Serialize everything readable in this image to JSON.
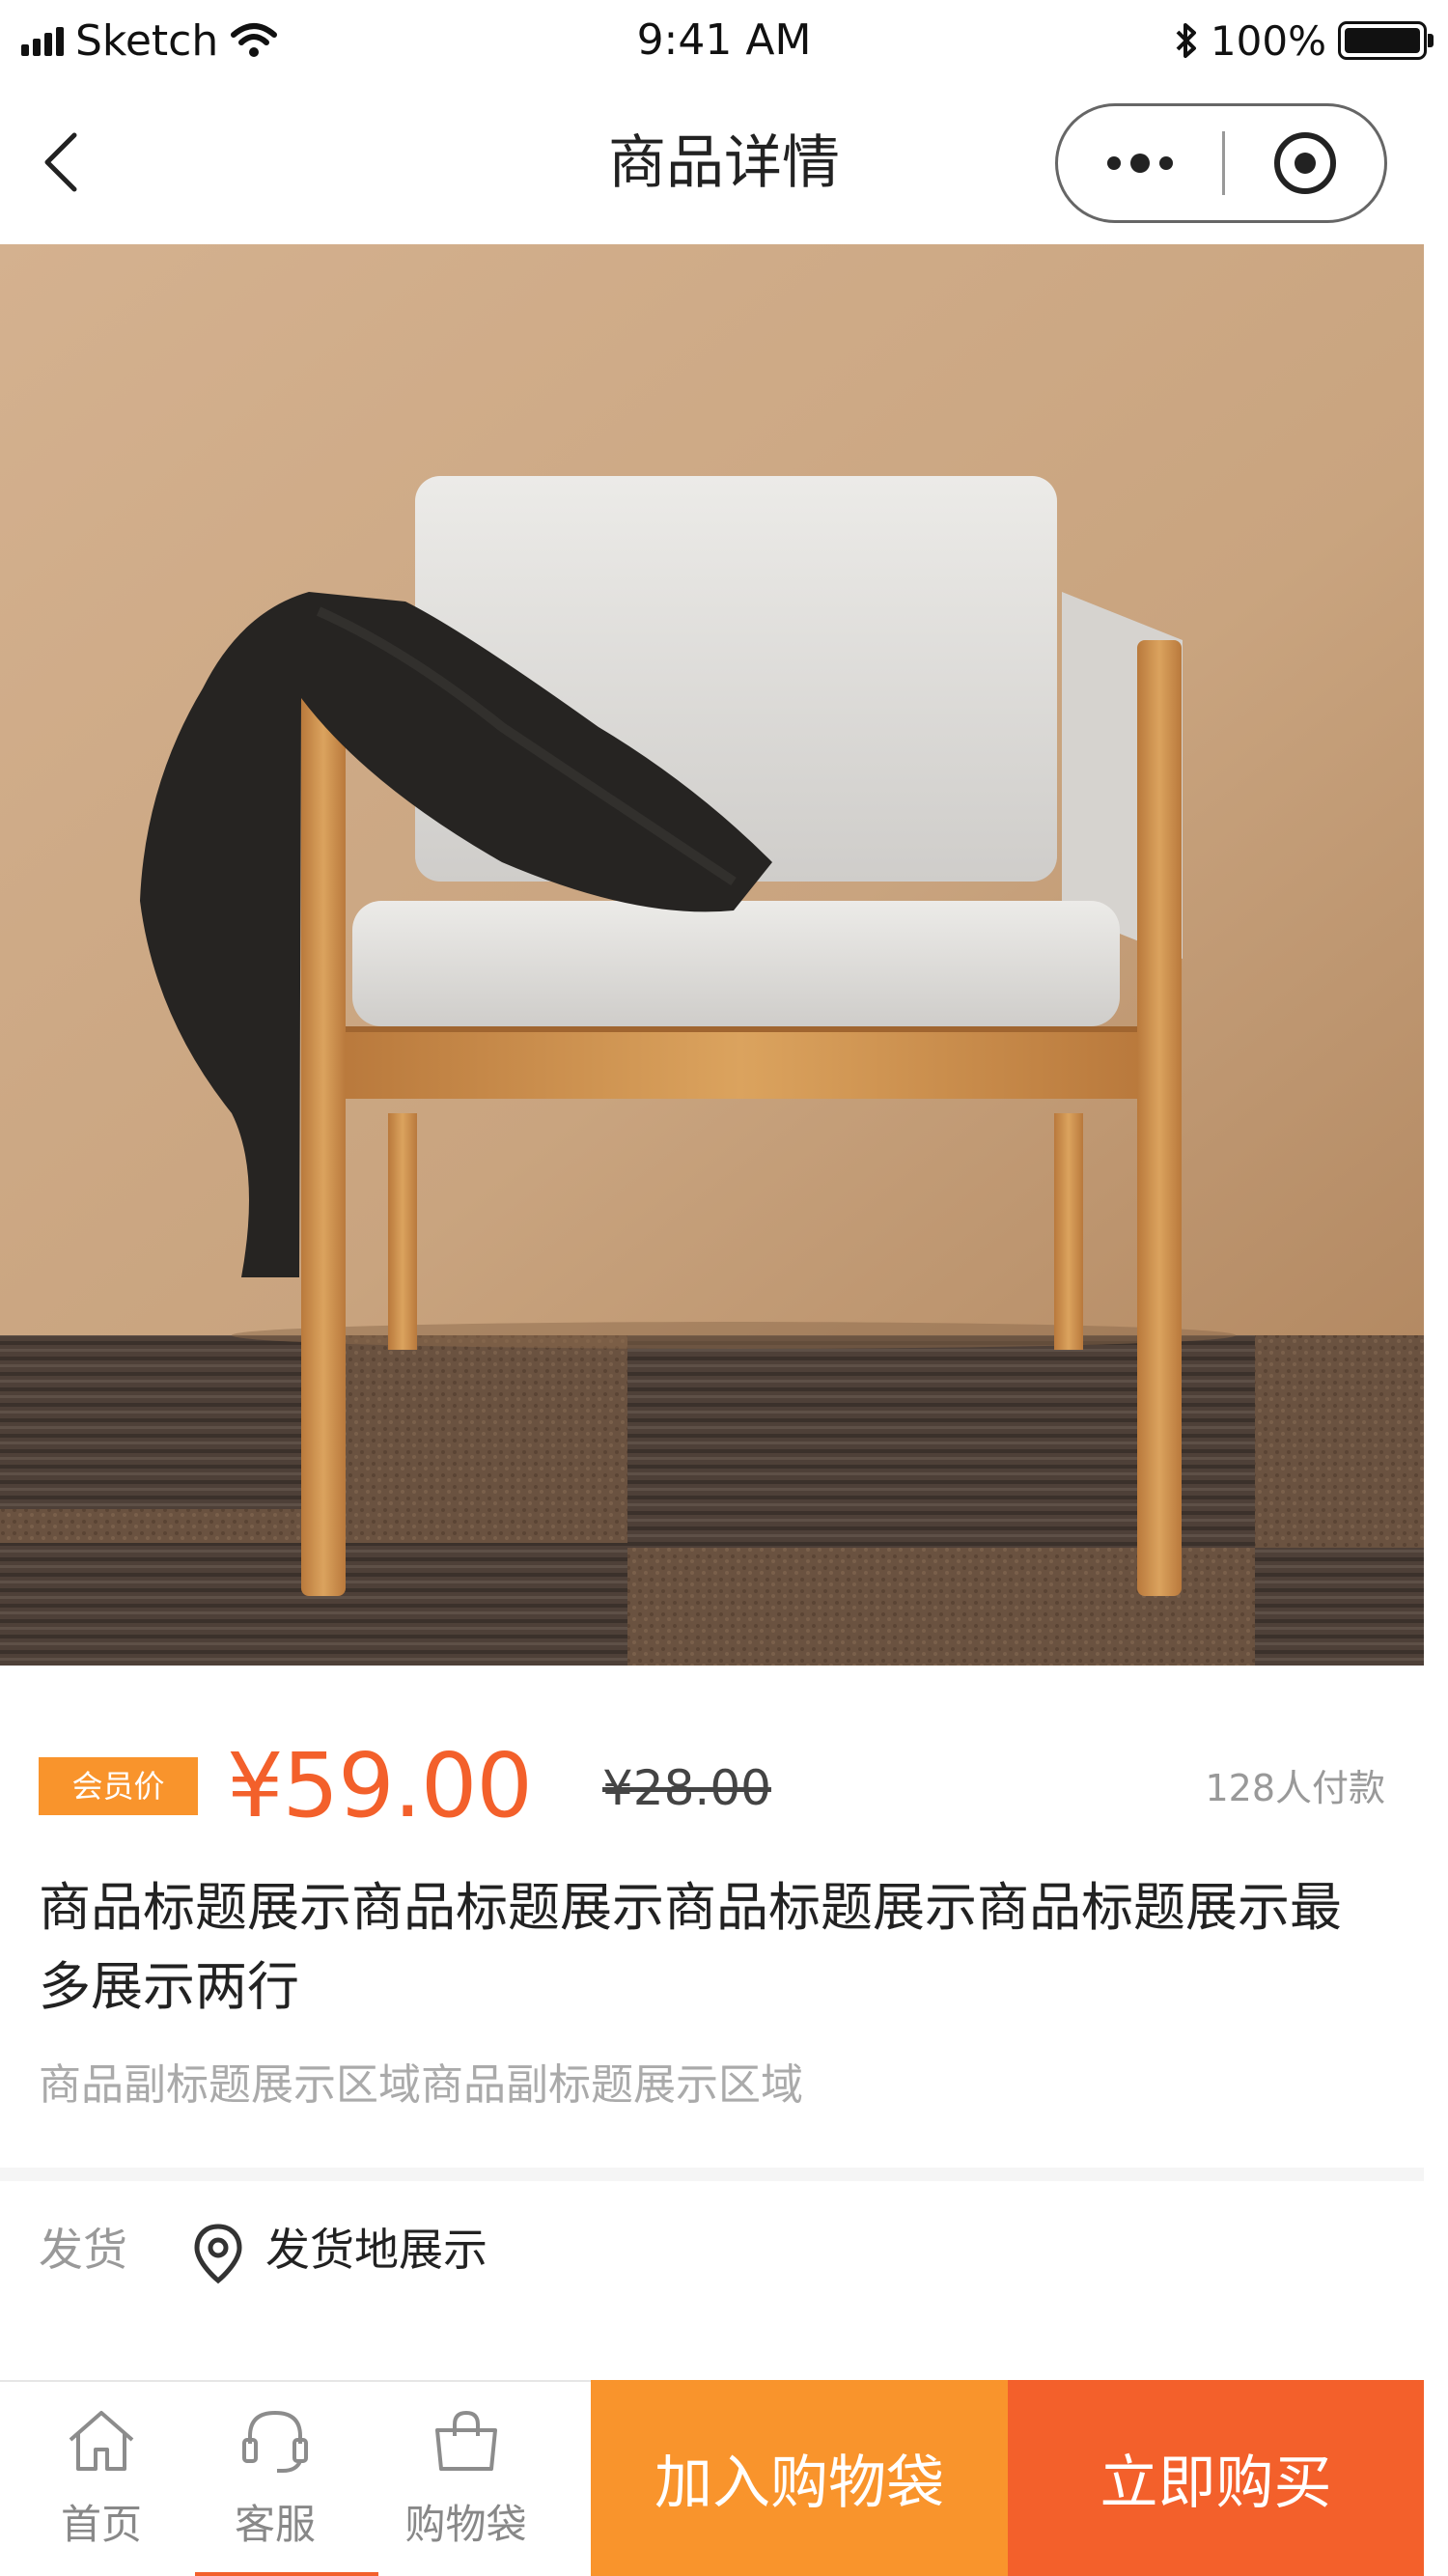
{
  "status_bar": {
    "carrier": "Sketch",
    "time": "9:41 AM",
    "battery": "100%",
    "icons": [
      "signal-icon",
      "wifi-icon",
      "bluetooth-icon",
      "battery-icon"
    ]
  },
  "nav": {
    "title": "商品详情",
    "icons": [
      "back-icon",
      "more-icon",
      "close-target-icon"
    ]
  },
  "gallery": {
    "image": "chair-product-photo",
    "slide_count": 5,
    "active_slide": 1
  },
  "product": {
    "member_tag": "会员价",
    "price": "¥59.00",
    "original_price": "¥28.00",
    "sales": "128人付款",
    "title": "商品标题展示商品标题展示商品标题展示商品标题展示最多展示两行",
    "subtitle": "商品副标题展示区域商品副标题展示区域"
  },
  "shipping": {
    "label": "发货",
    "value": "发货地展示",
    "icon": "location-icon"
  },
  "bottom_bar": {
    "tabs": [
      {
        "label": "首页",
        "icon": "home-icon"
      },
      {
        "label": "客服",
        "icon": "headset-icon"
      },
      {
        "label": "购物袋",
        "icon": "shopping-bag-icon"
      }
    ],
    "add_to_cart": "加入购物袋",
    "buy_now": "立即购买"
  },
  "colors": {
    "accent_orange": "#f9942c",
    "accent_red": "#f3602b",
    "text_primary": "#222222",
    "text_secondary": "#999999"
  }
}
